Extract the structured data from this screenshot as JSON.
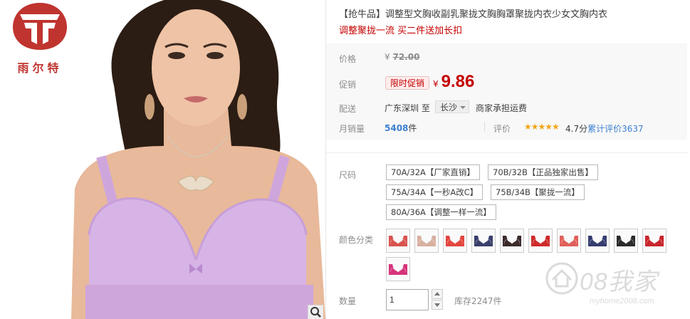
{
  "brand": {
    "logo_text": "雨尔特",
    "color": "#c0342f"
  },
  "product": {
    "title": "【抢牛品】调整型文胸收副乳聚拢文胸胸罩聚拢内衣少女文胸内衣",
    "subtitle": "调整聚拢一流 买二件送加长扣"
  },
  "pricing": {
    "price_label": "价格",
    "currency": "¥",
    "original_price": "72.00",
    "promo_label": "促销",
    "promo_badge": "限时促销",
    "promo_price": "9.86",
    "accent_color": "#c40000"
  },
  "shipping": {
    "label": "配送",
    "from": "广东深圳",
    "to_word": "至",
    "destination": "长沙",
    "fee_text": "商家承担运费"
  },
  "sales": {
    "label": "月销量",
    "count": "5408",
    "unit": "件",
    "rating_label": "评价",
    "stars": "★★★★★",
    "rating_score": "4.7分",
    "review_text": "累计评价3637"
  },
  "sizes": {
    "label": "尺码",
    "options": [
      "70A/32A【厂家直销】",
      "70B/32B【正品独家出售】",
      "75A/34A【一秒A改C】",
      "75B/34B【聚拢一流】",
      "80A/36A【调整一样一流】"
    ]
  },
  "colors": {
    "label": "颜色分类",
    "swatch_colors": [
      "#d9534f",
      "#d8b0a0",
      "#e2463f",
      "#3a3f6b",
      "#3b2b2b",
      "#cf2b2b",
      "#e0605a",
      "#353c6e",
      "#2a2a2a",
      "#c9252b",
      "#d6337a"
    ]
  },
  "quantity": {
    "label": "数量",
    "value": "1",
    "stock_text": "库存2247件"
  },
  "watermark": {
    "main": "08我家",
    "sub": "myhome2008.com"
  }
}
